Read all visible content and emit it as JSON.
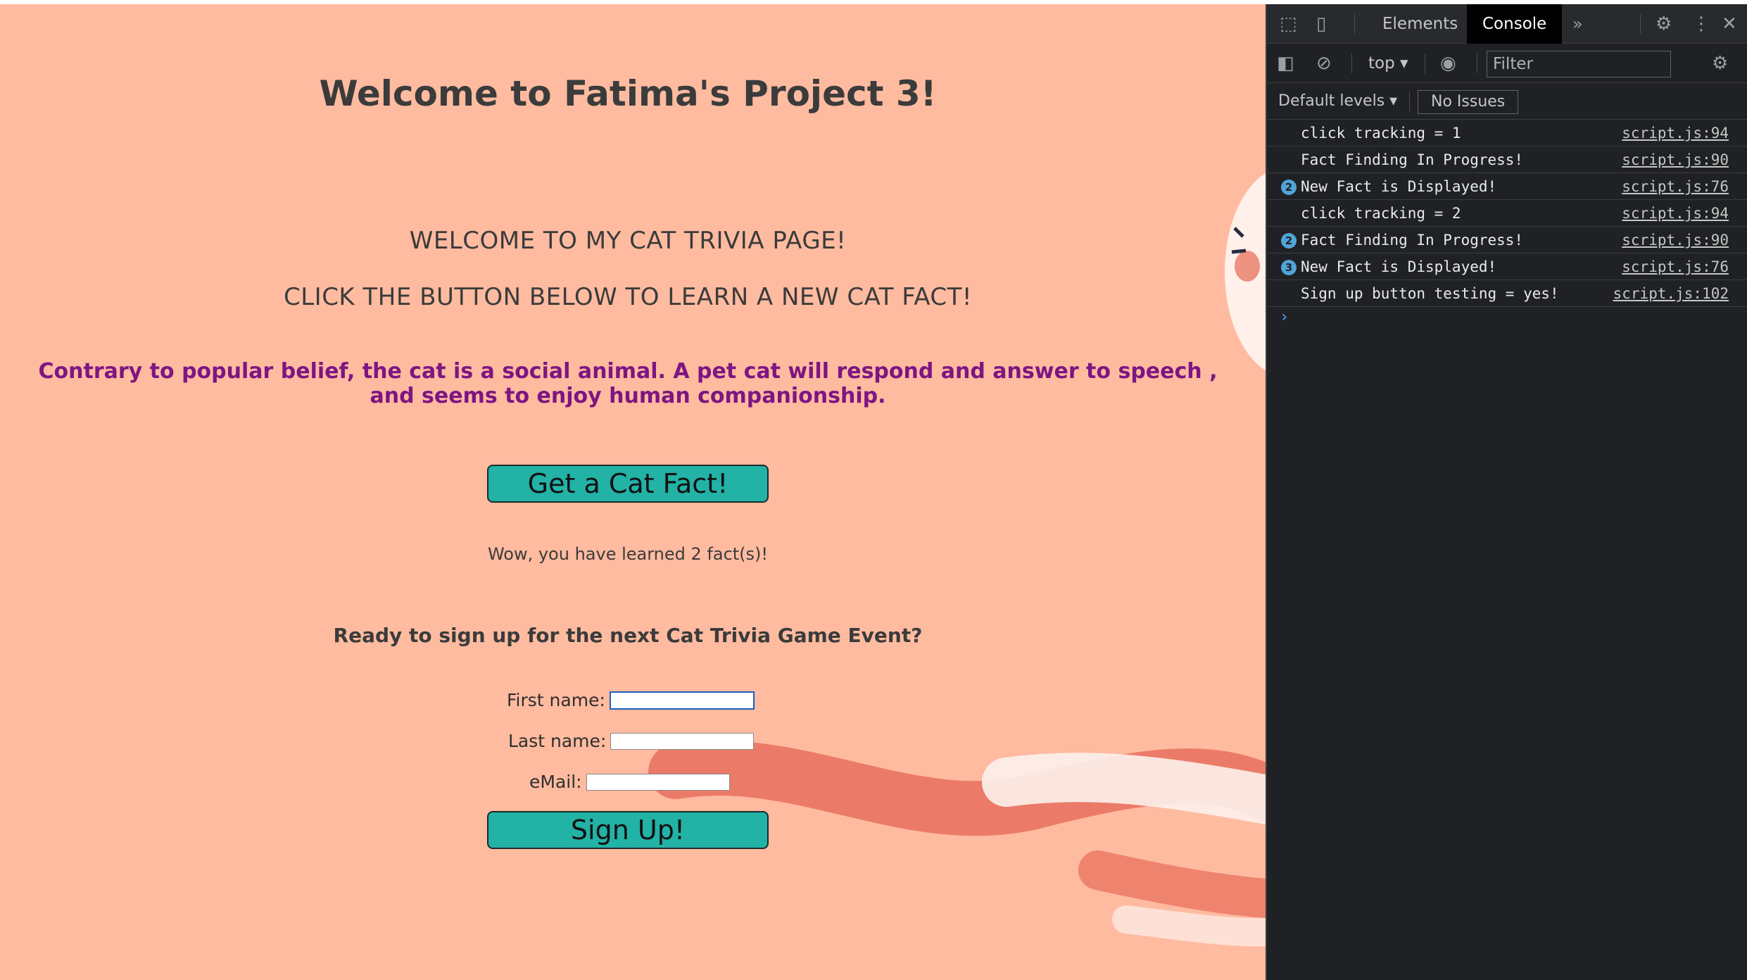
{
  "page": {
    "title": "Welcome to Fatima's Project 3!",
    "welcome_line1": "WELCOME TO MY CAT TRIVIA PAGE!",
    "welcome_line2": "CLICK THE BUTTON BELOW TO LEARN A NEW CAT FACT!",
    "fact": "Contrary to popular belief, the cat is a social animal. A pet cat will respond and answer to speech , and seems to enjoy human companionship.",
    "fact_button": "Get a Cat Fact!",
    "counter": "Wow, you have learned 2 fact(s)!",
    "signup_heading": "Ready to sign up for the next Cat Trivia Game Event?",
    "form": {
      "first_name_label": "First name:",
      "first_name_value": "",
      "last_name_label": "Last name:",
      "last_name_value": "",
      "email_label": "eMail:",
      "email_value": ""
    },
    "signup_button": "Sign Up!",
    "colors": {
      "background": "#ffbba0",
      "button": "#22b2a6",
      "fact_text": "#7e1582",
      "decor_stripe": "#e8705e"
    }
  },
  "devtools": {
    "tabs": [
      "Elements",
      "Console"
    ],
    "active_tab": "Console",
    "more_tabs_icon": "chevron-double-right-icon",
    "context": "top",
    "filter_placeholder": "Filter",
    "levels": "Default levels",
    "issues": "No Issues",
    "logs": [
      {
        "count": "",
        "message": "click tracking = 1",
        "source": "script.js:94"
      },
      {
        "count": "",
        "message": "Fact Finding In Progress!",
        "source": "script.js:90"
      },
      {
        "count": "2",
        "message": "New Fact is Displayed!",
        "source": "script.js:76"
      },
      {
        "count": "",
        "message": "click tracking = 2",
        "source": "script.js:94"
      },
      {
        "count": "2",
        "message": "Fact Finding In Progress!",
        "source": "script.js:90"
      },
      {
        "count": "3",
        "message": "New Fact is Displayed!",
        "source": "script.js:76"
      },
      {
        "count": "",
        "message": "Sign up button testing = yes!",
        "source": "script.js:102"
      }
    ],
    "prompt": "›",
    "colors": {
      "panel": "#202124",
      "badge": "#4fa5d8",
      "active_tab": "#000000"
    }
  }
}
